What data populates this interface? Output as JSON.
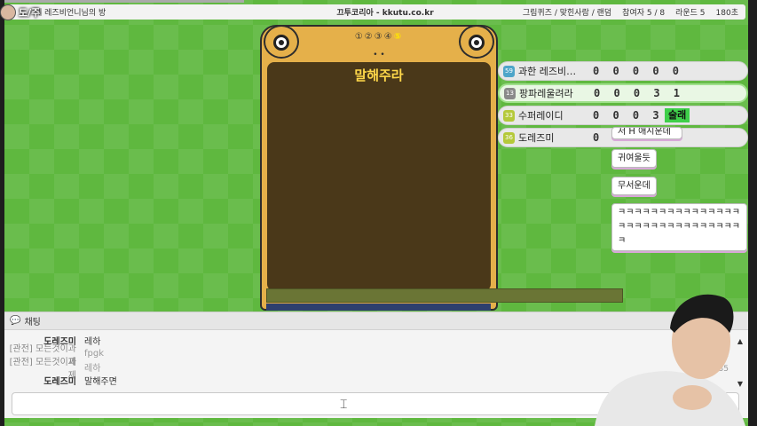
{
  "header": {
    "overlay_text": "도/주",
    "room_title": "제 레즈비언니님의 방",
    "site": "끄투코리아 - kkutu.co.kr",
    "mode": "그림퀴즈 / 맞힌사람 / 랜덤",
    "participants": "참여자 5 / 8",
    "round": "라운드 5",
    "time": "180초"
  },
  "board": {
    "rounds": [
      "①",
      "②",
      "③",
      "④",
      "⑤"
    ],
    "current_round_index": 4,
    "dots": "• •",
    "prompt": "말해주라"
  },
  "players": [
    {
      "level": "59",
      "level_color": "#4ea5c9",
      "name": "과한 레즈비…",
      "score": "0 0 0 0 0",
      "active": false
    },
    {
      "level": "13",
      "level_color": "#8a8a8a",
      "name": "팡파레울려라",
      "score": "0 0 0 3 1",
      "active": true
    },
    {
      "level": "33",
      "level_color": "#b5c93a",
      "name": "수퍼레이디",
      "score": "0 0 0 3 8",
      "active": false,
      "badge": "술래"
    },
    {
      "level": "36",
      "level_color": "#b5c93a",
      "name": "도레즈미",
      "score": "0 0",
      "active": false
    }
  ],
  "bubbles": [
    "저 H 애시운데",
    "귀여울듯",
    "무서운데",
    "ㅋㅋㅋㅋㅋㅋㅋㅋㅋㅋㅋㅋㅋㅋㅋㅋㅋㅋㅋㅋㅋㅋㅋㅋㅋㅋㅋㅋㅋㅋㅋ"
  ],
  "chat": {
    "title": "채팅",
    "messages": [
      {
        "who": "도레즈미",
        "msg": "레하",
        "spectator": false
      },
      {
        "who": "[관전] 모든것이과제",
        "msg": "fpgk",
        "spectator": true
      },
      {
        "who": "[관전] 모든것이과제",
        "msg": "레하",
        "spectator": true
      },
      {
        "who": "도레즈미",
        "msg": "말해주면",
        "spectator": false
      }
    ],
    "times": [
      "34",
      ":35"
    ],
    "input_value": ""
  },
  "colors": {
    "background": "#5fb83f",
    "board": "#e5b04a",
    "screen": "#4a3819",
    "prompt": "#ffd84a",
    "badge": "#3fcf4a"
  }
}
